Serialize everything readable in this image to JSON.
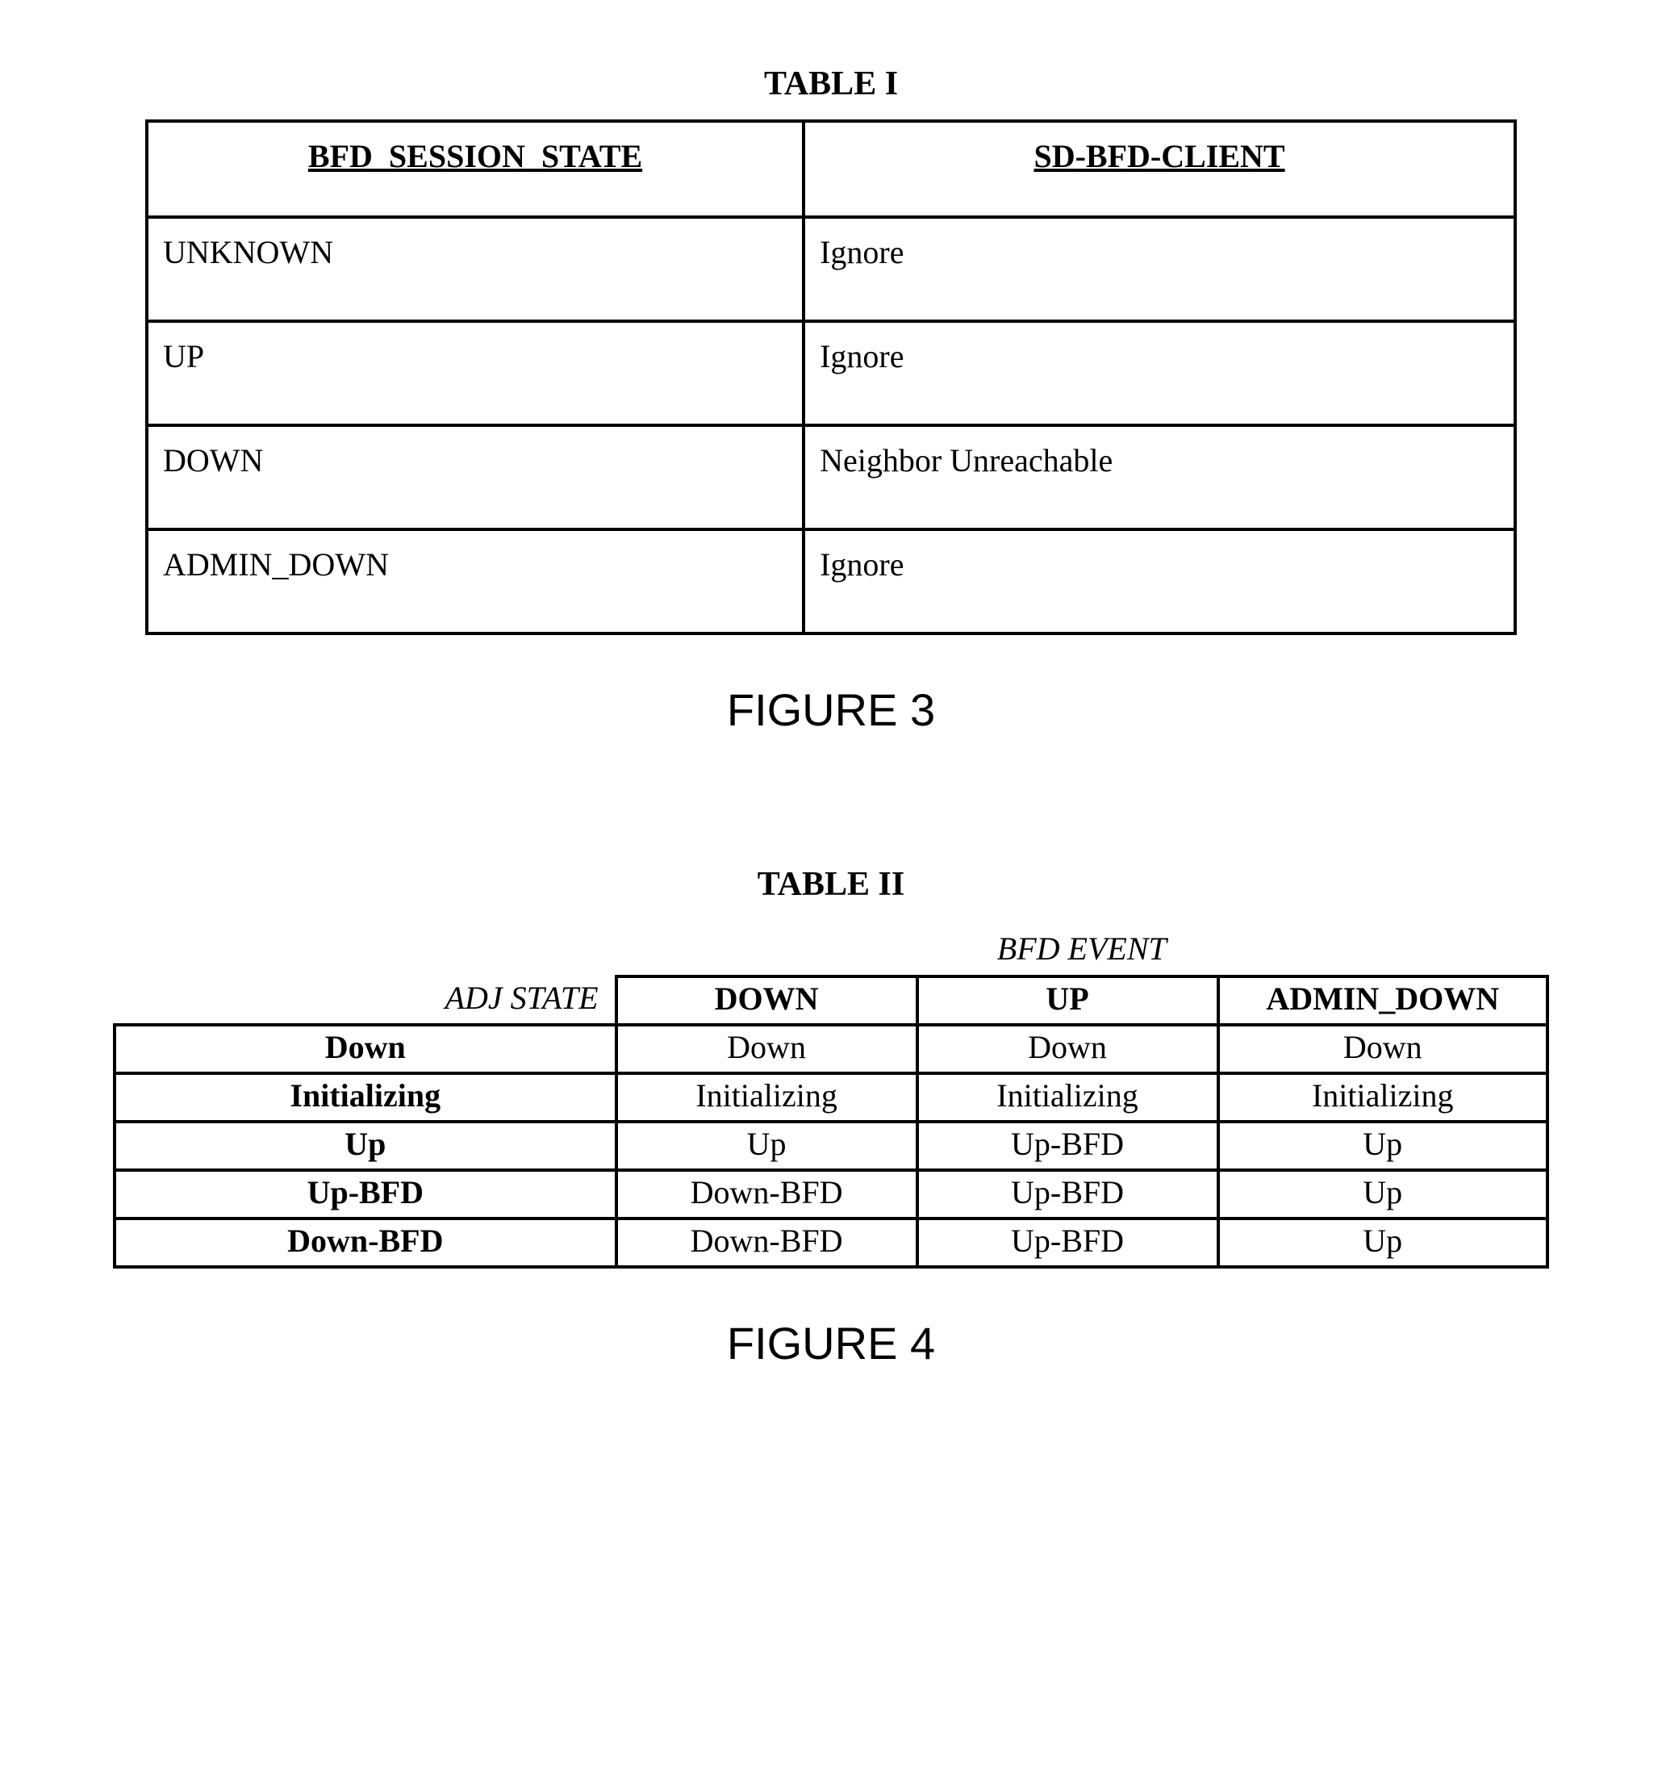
{
  "table1": {
    "title": "TABLE I",
    "headers": [
      "BFD_SESSION_STATE",
      "SD-BFD-CLIENT"
    ],
    "rows": [
      [
        "UNKNOWN",
        "Ignore"
      ],
      [
        "UP",
        "Ignore"
      ],
      [
        "DOWN",
        "Neighbor Unreachable"
      ],
      [
        "ADMIN_DOWN",
        "Ignore"
      ]
    ],
    "figure": "FIGURE 3"
  },
  "table2": {
    "title": "TABLE II",
    "super_header": "BFD EVENT",
    "adj_state_label": "ADJ STATE",
    "col_headers": [
      "DOWN",
      "UP",
      "ADMIN_DOWN"
    ],
    "rows": [
      {
        "label": "Down",
        "cells": [
          "Down",
          "Down",
          "Down"
        ]
      },
      {
        "label": "Initializing",
        "cells": [
          "Initializing",
          "Initializing",
          "Initializing"
        ]
      },
      {
        "label": "Up",
        "cells": [
          "Up",
          "Up-BFD",
          "Up"
        ]
      },
      {
        "label": "Up-BFD",
        "cells": [
          "Down-BFD",
          "Up-BFD",
          "Up"
        ]
      },
      {
        "label": "Down-BFD",
        "cells": [
          "Down-BFD",
          "Up-BFD",
          "Up"
        ]
      }
    ],
    "figure": "FIGURE 4"
  }
}
